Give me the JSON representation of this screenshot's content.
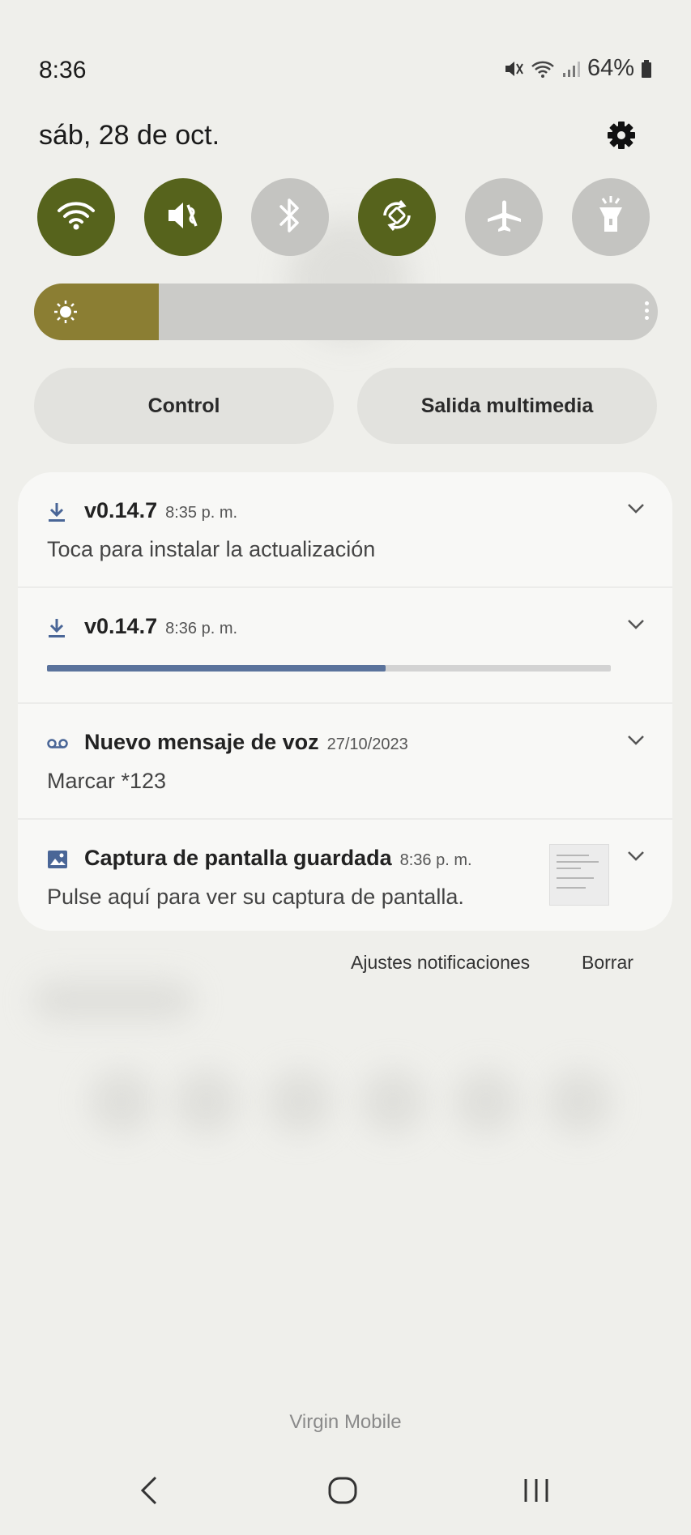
{
  "status_bar": {
    "time": "8:36",
    "battery": "64%",
    "icons": [
      "mute-icon",
      "wifi-icon",
      "signal-icon",
      "battery-icon"
    ]
  },
  "header": {
    "date": "sáb, 28 de oct.",
    "settings_icon": "gear-icon"
  },
  "quick_toggles": [
    {
      "name": "wifi",
      "icon": "wifi-icon",
      "state": "on"
    },
    {
      "name": "sound",
      "icon": "mute-icon",
      "state": "on"
    },
    {
      "name": "bluetooth",
      "icon": "bluetooth-icon",
      "state": "off"
    },
    {
      "name": "rotation",
      "icon": "rotate-icon",
      "state": "on"
    },
    {
      "name": "airplane",
      "icon": "airplane-icon",
      "state": "off"
    },
    {
      "name": "flashlight",
      "icon": "flashlight-icon",
      "state": "off"
    }
  ],
  "brightness": {
    "level": 0.2
  },
  "buttons": {
    "control": "Control",
    "media_output": "Salida multimedia"
  },
  "notifications": [
    {
      "icon": "download-icon",
      "title": "v0.14.7",
      "time": "8:35 p. m.",
      "body": "Toca para instalar la actualización"
    },
    {
      "icon": "download-icon",
      "title": "v0.14.7",
      "time": "8:36 p. m.",
      "progress": 0.6
    },
    {
      "icon": "voicemail-icon",
      "title": "Nuevo mensaje de voz",
      "time": "27/10/2023",
      "body": "Marcar *123"
    },
    {
      "icon": "image-icon",
      "title": "Captura de pantalla guardada",
      "time": "8:36 p. m.",
      "body": "Pulse aquí para ver su captura de pantalla."
    }
  ],
  "footer": {
    "settings": "Ajustes notificaciones",
    "clear": "Borrar",
    "carrier": "Virgin Mobile"
  },
  "colors": {
    "toggle_on": "#56631c",
    "toggle_off": "#c4c4c1",
    "brightness_fill": "#8b7e33",
    "progress": "#5b739c"
  }
}
